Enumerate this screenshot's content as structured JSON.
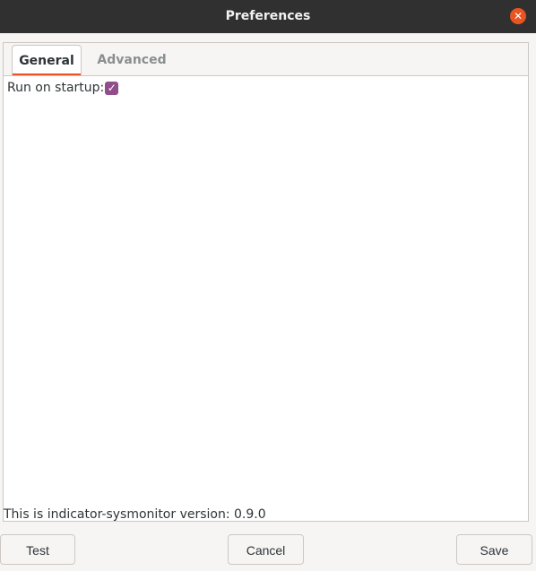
{
  "window": {
    "title": "Preferences",
    "close_symbol": "✕",
    "close_icon": "close-icon"
  },
  "tabs": [
    {
      "label": "General",
      "active": true
    },
    {
      "label": "Advanced",
      "active": false
    }
  ],
  "general": {
    "run_on_startup_label": "Run on startup:",
    "run_on_startup_checked": true,
    "check_symbol": "✓",
    "version_text": "This is indicator-sysmonitor version: 0.9.0"
  },
  "buttons": {
    "test": "Test",
    "cancel": "Cancel",
    "save": "Save"
  },
  "colors": {
    "accent": "#e95420",
    "checkbox": "#924d8b",
    "titlebar": "#303030"
  }
}
